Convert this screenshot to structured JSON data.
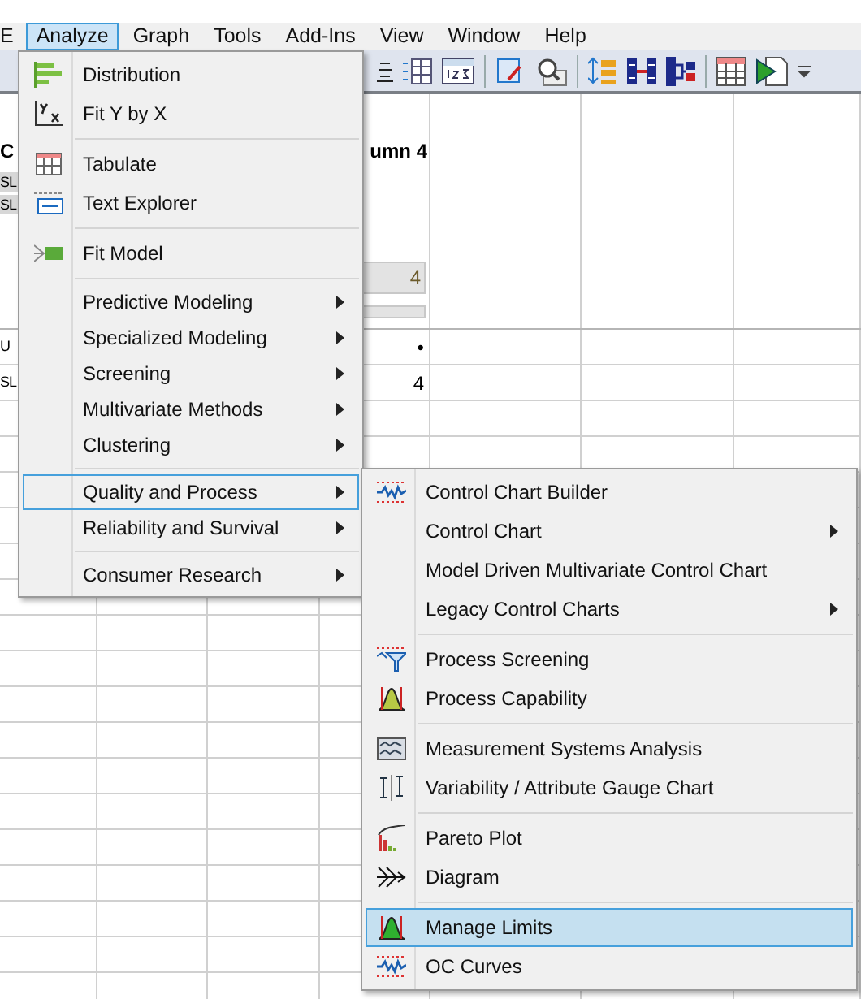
{
  "menubar": [
    {
      "label": "E",
      "selected": false
    },
    {
      "label": "Analyze",
      "selected": true
    },
    {
      "label": "Graph",
      "selected": false
    },
    {
      "label": "Tools",
      "selected": false
    },
    {
      "label": "Add-Ins",
      "selected": false
    },
    {
      "label": "View",
      "selected": false
    },
    {
      "label": "Window",
      "selected": false
    },
    {
      "label": "Help",
      "selected": false
    }
  ],
  "table": {
    "headers": {
      "column_1": "C",
      "column_4": "umn 4"
    },
    "header_cells": [
      "SL",
      "SL"
    ],
    "column_4_summary": "4",
    "rows": [
      {
        "column_1": "U",
        "column_4": "•"
      },
      {
        "column_1": "SL",
        "column_4": "4"
      }
    ]
  },
  "analyze_menu": {
    "groups": [
      [
        {
          "label": "Distribution",
          "submenu": false,
          "selected": false
        },
        {
          "label": "Fit Y by X",
          "submenu": false,
          "selected": false
        }
      ],
      [
        {
          "label": "Tabulate",
          "submenu": false,
          "selected": false
        },
        {
          "label": "Text Explorer",
          "submenu": false,
          "selected": false
        }
      ],
      [
        {
          "label": "Fit Model",
          "submenu": false,
          "selected": false
        }
      ],
      [
        {
          "label": "Predictive Modeling",
          "submenu": true,
          "selected": false
        },
        {
          "label": "Specialized Modeling",
          "submenu": true,
          "selected": false
        },
        {
          "label": "Screening",
          "submenu": true,
          "selected": false
        },
        {
          "label": "Multivariate Methods",
          "submenu": true,
          "selected": false
        },
        {
          "label": "Clustering",
          "submenu": true,
          "selected": false
        }
      ],
      [
        {
          "label": "Quality and Process",
          "submenu": true,
          "selected": true
        },
        {
          "label": "Reliability and Survival",
          "submenu": true,
          "selected": false
        }
      ],
      [
        {
          "label": "Consumer Research",
          "submenu": true,
          "selected": false
        }
      ]
    ]
  },
  "quality_submenu": {
    "groups": [
      [
        {
          "label": "Control Chart Builder",
          "submenu": false,
          "selected": false
        },
        {
          "label": "Control Chart",
          "submenu": true,
          "selected": false
        },
        {
          "label": "Model Driven Multivariate Control Chart",
          "submenu": false,
          "selected": false
        },
        {
          "label": "Legacy Control Charts",
          "submenu": true,
          "selected": false
        }
      ],
      [
        {
          "label": "Process Screening",
          "submenu": false,
          "selected": false
        },
        {
          "label": "Process Capability",
          "submenu": false,
          "selected": false
        }
      ],
      [
        {
          "label": "Measurement Systems Analysis",
          "submenu": false,
          "selected": false
        },
        {
          "label": "Variability / Attribute Gauge Chart",
          "submenu": false,
          "selected": false
        }
      ],
      [
        {
          "label": "Pareto Plot",
          "submenu": false,
          "selected": false
        },
        {
          "label": "Diagram",
          "submenu": false,
          "selected": false
        }
      ],
      [
        {
          "label": "Manage Limits",
          "submenu": false,
          "selected": true
        },
        {
          "label": "OC Curves",
          "submenu": false,
          "selected": false
        }
      ]
    ]
  }
}
